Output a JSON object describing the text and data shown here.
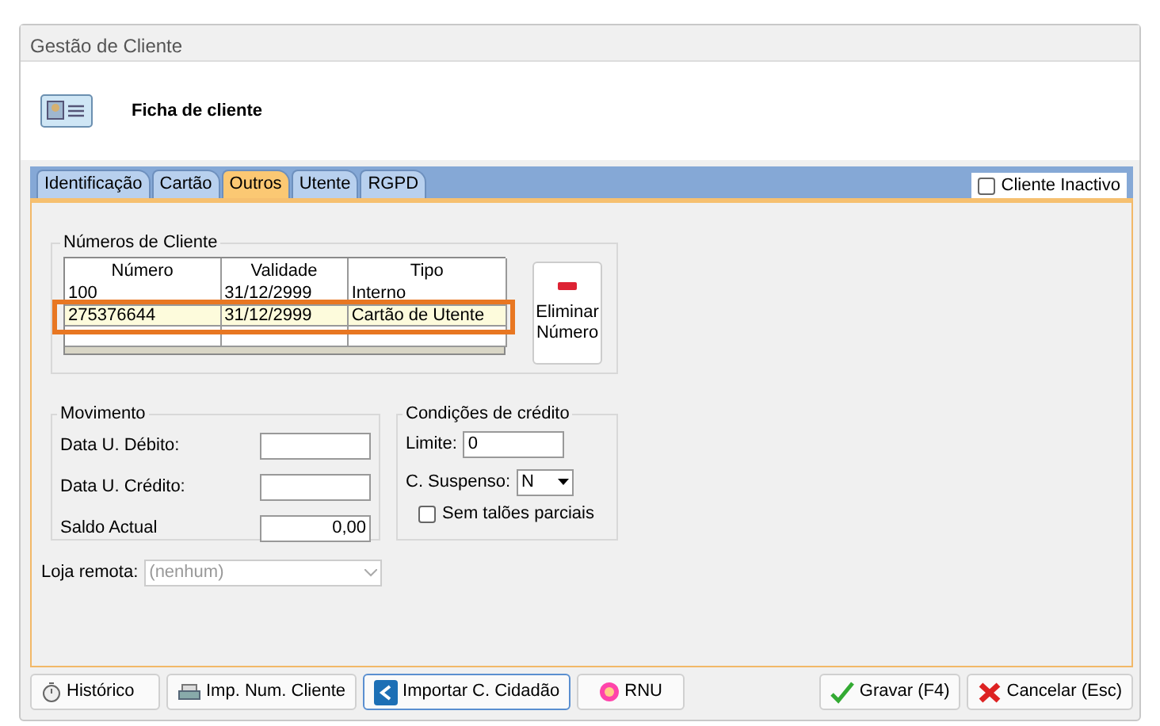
{
  "window": {
    "title": "Gestão de Cliente"
  },
  "header": {
    "title": "Ficha de cliente"
  },
  "tabs": [
    {
      "label": "Identificação",
      "selected": false
    },
    {
      "label": "Cartão",
      "selected": false
    },
    {
      "label": "Outros",
      "selected": true
    },
    {
      "label": "Utente",
      "selected": false
    },
    {
      "label": "RGPD",
      "selected": false
    }
  ],
  "inactive_checkbox": {
    "label": "Cliente Inactivo",
    "checked": false
  },
  "client_numbers": {
    "title": "Números de Cliente",
    "annotation_frame": true,
    "columns": [
      "Número",
      "Validade",
      "Tipo"
    ],
    "rows": [
      {
        "cells": [
          "100",
          "31/12/2999",
          "Interno"
        ],
        "selected": false
      },
      {
        "cells": [
          "275376644",
          "31/12/2999",
          "Cartão de Utente"
        ],
        "selected": true
      }
    ],
    "delete_button": "Eliminar Número"
  },
  "movement": {
    "title": "Movimento",
    "fields": [
      {
        "label": "Data U. Débito:"
      },
      {
        "label": "Data U. Crédito:"
      },
      {
        "label": "Saldo Actual",
        "value": "0,00"
      }
    ]
  },
  "credit": {
    "title": "Condições de crédito",
    "limit_label": "Limite:",
    "limit_value": "0",
    "suspended_label": "C. Suspenso:",
    "suspended_value": "N",
    "partial_checkbox": {
      "label": "Sem talões parciais",
      "checked": false
    }
  },
  "remote_store": {
    "label": "Loja remota:",
    "value": "(nenhum)",
    "disabled": true
  },
  "buttons": [
    {
      "label": "Histórico",
      "kind": "history"
    },
    {
      "label": "Imp. Num. Cliente",
      "kind": "print"
    },
    {
      "label": "Importar C. Cidadão",
      "kind": "import"
    },
    {
      "label": "RNU",
      "kind": "rnu"
    }
  ],
  "action_buttons": [
    {
      "label": "Gravar (F4)",
      "kind": "save"
    },
    {
      "label": "Cancelar (Esc)",
      "kind": "cancel"
    }
  ]
}
